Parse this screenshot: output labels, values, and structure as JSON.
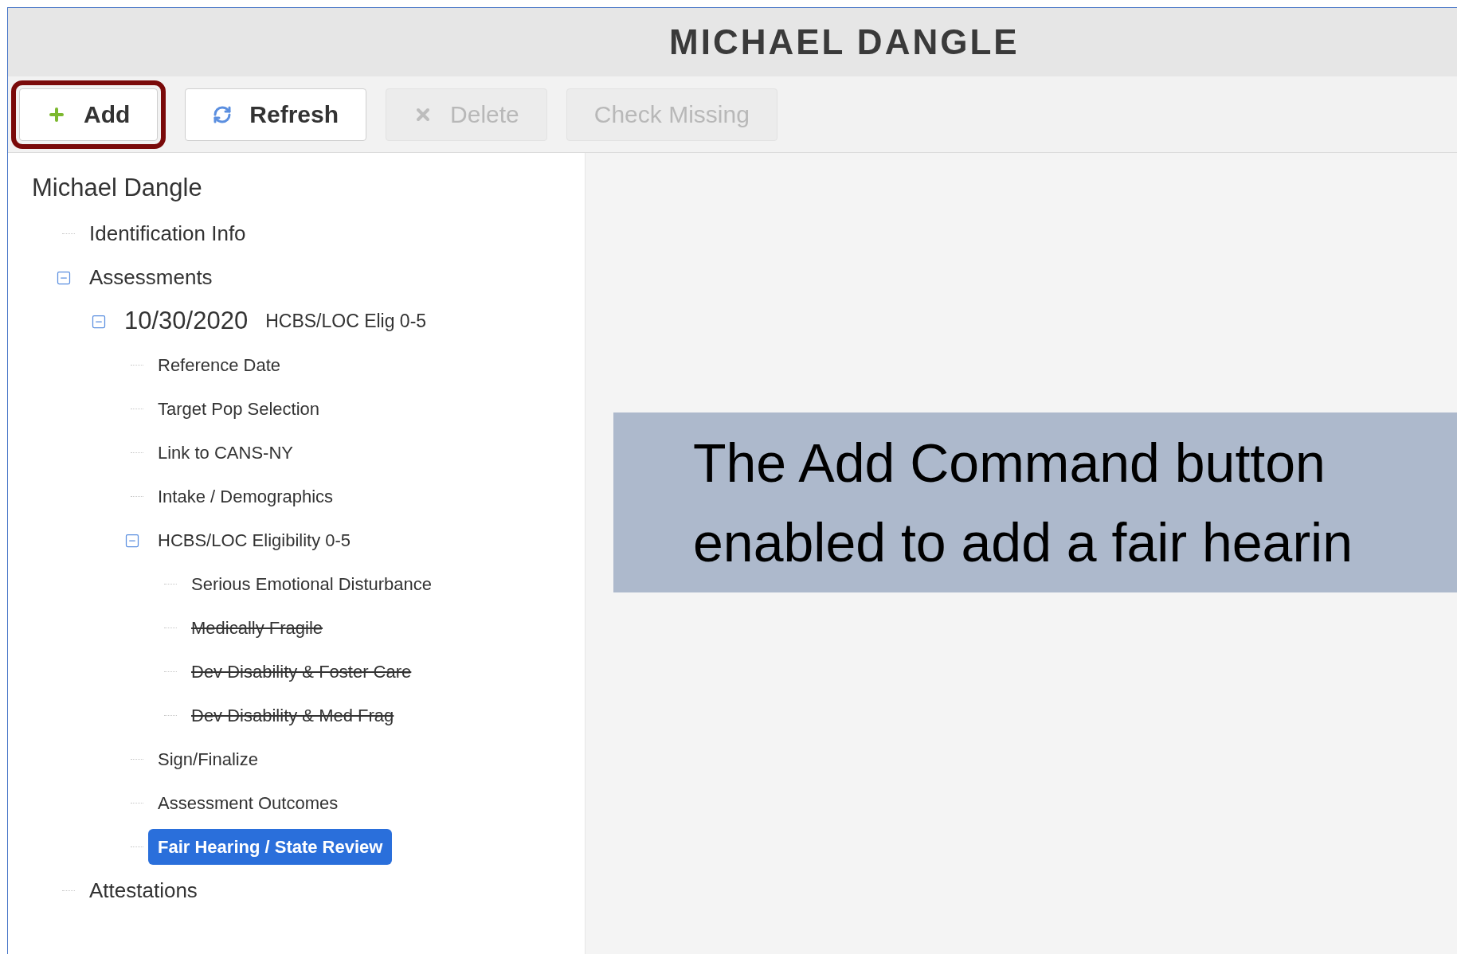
{
  "window": {
    "title": "MICHAEL DANGLE"
  },
  "toolbar": {
    "buttons": [
      {
        "label": "Add",
        "kind": "add",
        "disabled": false,
        "highlighted": true
      },
      {
        "label": "Refresh",
        "kind": "refresh",
        "disabled": false,
        "highlighted": false
      },
      {
        "label": "Delete",
        "kind": "delete",
        "disabled": true,
        "highlighted": false
      },
      {
        "label": "Check Missing",
        "kind": "none",
        "disabled": true,
        "highlighted": false
      }
    ]
  },
  "tree": {
    "label": "Michael Dangle",
    "children": [
      {
        "label": "Identification Info"
      },
      {
        "label": "Assessments",
        "expanded": true,
        "children": [
          {
            "label": "10/30/2020",
            "subtitle": "HCBS/LOC Elig 0-5",
            "expanded": true,
            "children": [
              {
                "label": "Reference Date"
              },
              {
                "label": "Target Pop Selection"
              },
              {
                "label": "Link to CANS-NY"
              },
              {
                "label": "Intake / Demographics"
              },
              {
                "label": "HCBS/LOC Eligibility 0-5",
                "expanded": true,
                "children": [
                  {
                    "label": "Serious Emotional Disturbance",
                    "struck": false
                  },
                  {
                    "label": "Medically Fragile",
                    "struck": true
                  },
                  {
                    "label": "Dev Disability & Foster Care",
                    "struck": true
                  },
                  {
                    "label": "Dev Disability & Med Frag",
                    "struck": true
                  }
                ]
              },
              {
                "label": "Sign/Finalize"
              },
              {
                "label": "Assessment Outcomes"
              },
              {
                "label": "Fair Hearing / State Review",
                "selected": true
              }
            ]
          }
        ]
      },
      {
        "label": "Attestations"
      }
    ]
  },
  "callout": {
    "lines": [
      "The Add Command button",
      "enabled to add a fair hearin"
    ]
  }
}
